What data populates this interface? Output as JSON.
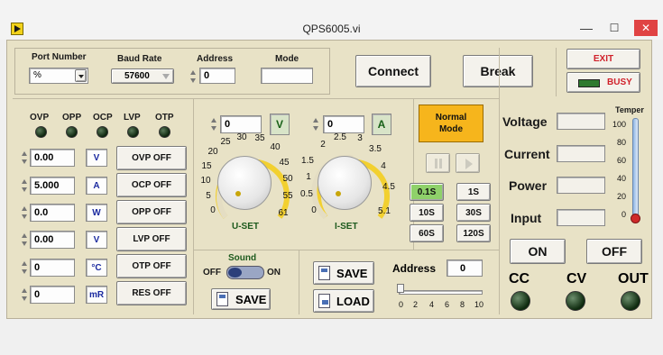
{
  "window": {
    "title": "QPS6005.vi",
    "minimize": "—",
    "maximize": "☐",
    "close": "✕"
  },
  "conn": {
    "port_label": "Port Number",
    "port_value": "%",
    "baud_label": "Baud Rate",
    "baud_value": "57600",
    "address_label": "Address",
    "address_value": "0",
    "mode_label": "Mode",
    "mode_value": "",
    "connect": "Connect",
    "break": "Break",
    "exit": "EXIT",
    "busy": "BUSY"
  },
  "protect": {
    "leds": [
      "OVP",
      "OPP",
      "OCP",
      "LVP",
      "OTP"
    ],
    "rows": [
      {
        "value": "0.00",
        "unit": "V",
        "button": "OVP OFF"
      },
      {
        "value": "5.000",
        "unit": "A",
        "button": "OCP OFF"
      },
      {
        "value": "0.0",
        "unit": "W",
        "button": "OPP OFF"
      },
      {
        "value": "0.00",
        "unit": "V",
        "button": "LVP OFF"
      },
      {
        "value": "0",
        "unit": "°C",
        "button": "OTP OFF"
      },
      {
        "value": "0",
        "unit": "mR",
        "button": "RES OFF"
      }
    ]
  },
  "uset": {
    "value": "0",
    "unit": "V",
    "label": "U-SET",
    "ticks": [
      "0",
      "5",
      "10",
      "15",
      "20",
      "25",
      "30",
      "35",
      "40",
      "45",
      "50",
      "55",
      "61"
    ]
  },
  "iset": {
    "value": "0",
    "unit": "A",
    "label": "I-SET",
    "ticks": [
      "0",
      "0.5",
      "1",
      "1.5",
      "2",
      "2.5",
      "3",
      "3.5",
      "4",
      "4.5",
      "5.1"
    ]
  },
  "mode_btn": "Normal Mode",
  "timer": {
    "times": [
      "0.1S",
      "1S",
      "10S",
      "30S",
      "60S",
      "120S"
    ]
  },
  "sound": {
    "label": "Sound",
    "off": "OFF",
    "on": "ON",
    "save": "SAVE"
  },
  "storage": {
    "save": "SAVE",
    "load": "LOAD",
    "address_label": "Address",
    "address_value": "0",
    "slider_ticks": [
      "0",
      "2",
      "4",
      "6",
      "8",
      "10"
    ],
    "slider_value": 0
  },
  "meter": {
    "voltage": "Voltage",
    "current": "Current",
    "power": "Power",
    "input": "Input",
    "temper": "Temper",
    "temp_ticks": [
      "100",
      "80",
      "60",
      "40",
      "20",
      "0"
    ],
    "temp_level": 0
  },
  "output": {
    "on": "ON",
    "off": "OFF",
    "cc": "CC",
    "cv": "CV",
    "out": "OUT"
  },
  "colors": {
    "panel": "#e8e2c6",
    "mode_orange": "#f6b51c",
    "timer_selected": "#8fd16a",
    "unit_blue": "#1c2ba0",
    "exit_red": "#d0202a"
  }
}
